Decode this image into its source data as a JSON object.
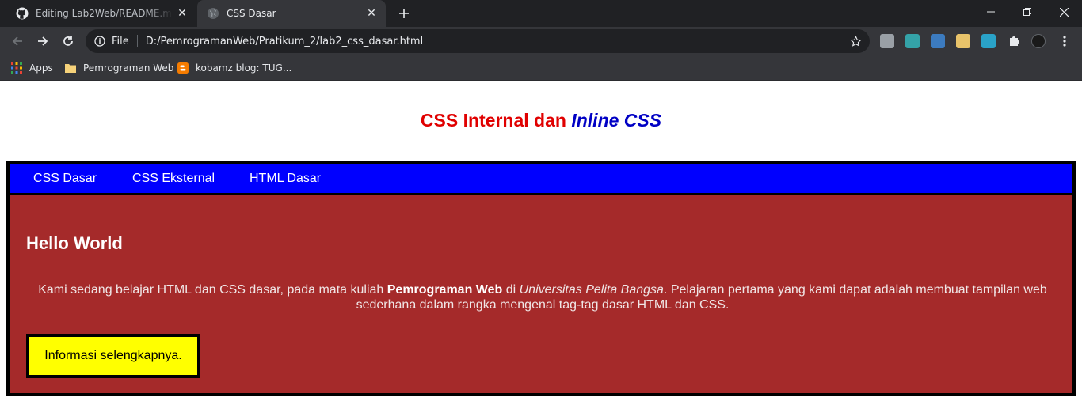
{
  "browser": {
    "tabs": [
      {
        "title": "Editing Lab2Web/README.md at",
        "active": false,
        "favicon": "github-icon"
      },
      {
        "title": "CSS Dasar",
        "active": true,
        "favicon": "globe-icon"
      }
    ],
    "address_bar": {
      "scheme_label": "File",
      "url": "D:/PemrogramanWeb/Pratikum_2/lab2_css_dasar.html"
    },
    "bookmarks": [
      {
        "label": "Apps",
        "icon": "apps-grid-icon"
      },
      {
        "label": "Pemrograman Web",
        "icon": "folder-icon"
      },
      {
        "label": "kobamz blog: TUG...",
        "icon": "blogger-icon"
      }
    ]
  },
  "page": {
    "title": {
      "part1": "CSS Internal dan ",
      "part2_italic": "Inline",
      "part3": " CSS"
    },
    "nav": [
      "CSS Dasar",
      "CSS Eksternal",
      "HTML Dasar"
    ],
    "heading": "Hello World",
    "paragraph": {
      "t1": "Kami sedang belajar HTML dan CSS dasar, pada mata kuliah ",
      "bold": "Pemrograman Web",
      "t2": " di ",
      "italic": "Universitas Pelita Bangsa",
      "t3": ". Pelajaran pertama yang kami dapat adalah membuat tampilan web sederhana dalam rangka mengenal tag-tag dasar HTML dan CSS."
    },
    "button": "Informasi selengkapnya."
  },
  "colors": {
    "title_red": "#e00000",
    "title_blue": "#0000c4",
    "nav_bg": "#0000ff",
    "content_bg": "#a52a2a",
    "button_bg": "#ffff00"
  }
}
